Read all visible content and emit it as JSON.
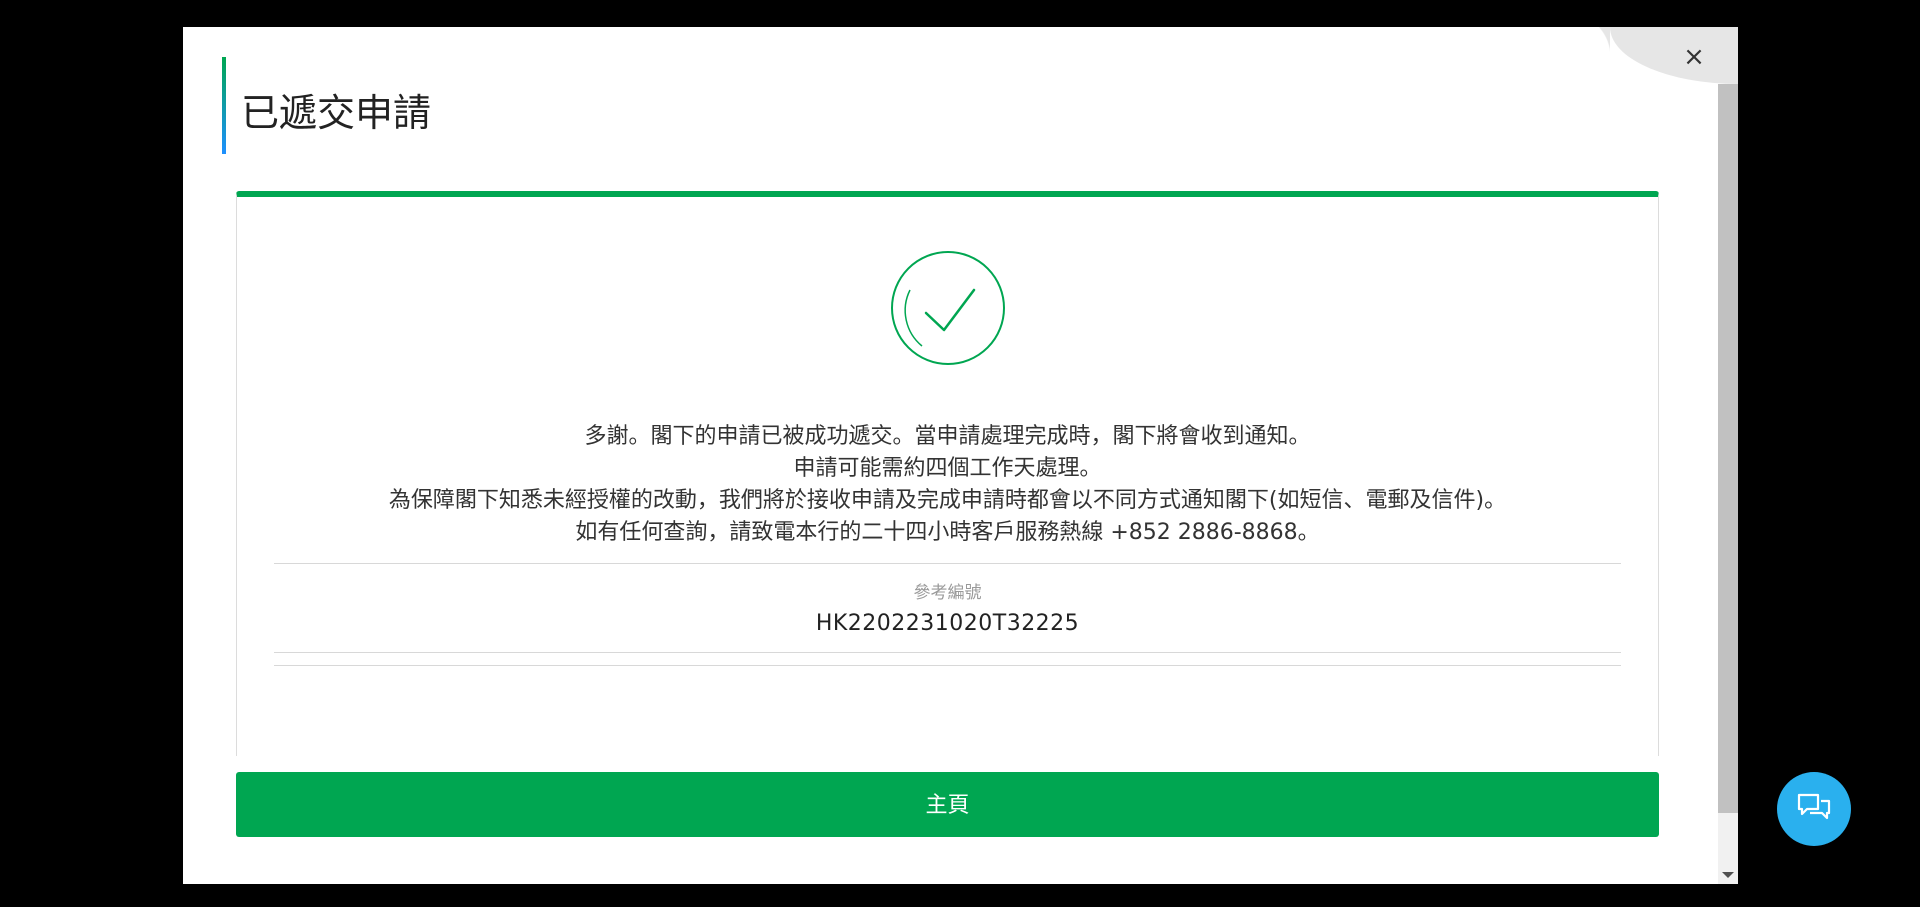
{
  "dialog": {
    "title": "已遞交申請",
    "close_label": "×"
  },
  "result": {
    "status_icon": "success-check-icon",
    "message_lines": [
      "多謝。閣下的申請已被成功遞交。當申請處理完成時，閣下將會收到通知。",
      "申請可能需約四個工作天處理。",
      "為保障閣下知悉未經授權的改動，我們將於接收申請及完成申請時都會以不同方式通知閣下(如短信、電郵及信件)。",
      "如有任何查詢，請致電本行的二十四小時客戶服務熱線 +852 2886-8868。"
    ],
    "reference_label": "參考編號",
    "reference_value": "HK2202231020T32225"
  },
  "actions": {
    "home_label": "主頁"
  },
  "chat": {
    "icon": "chat-bubbles-icon"
  },
  "colors": {
    "accent": "#00a651",
    "chat": "#2ab0ee",
    "title_bar_bottom": "#1e90ff"
  }
}
